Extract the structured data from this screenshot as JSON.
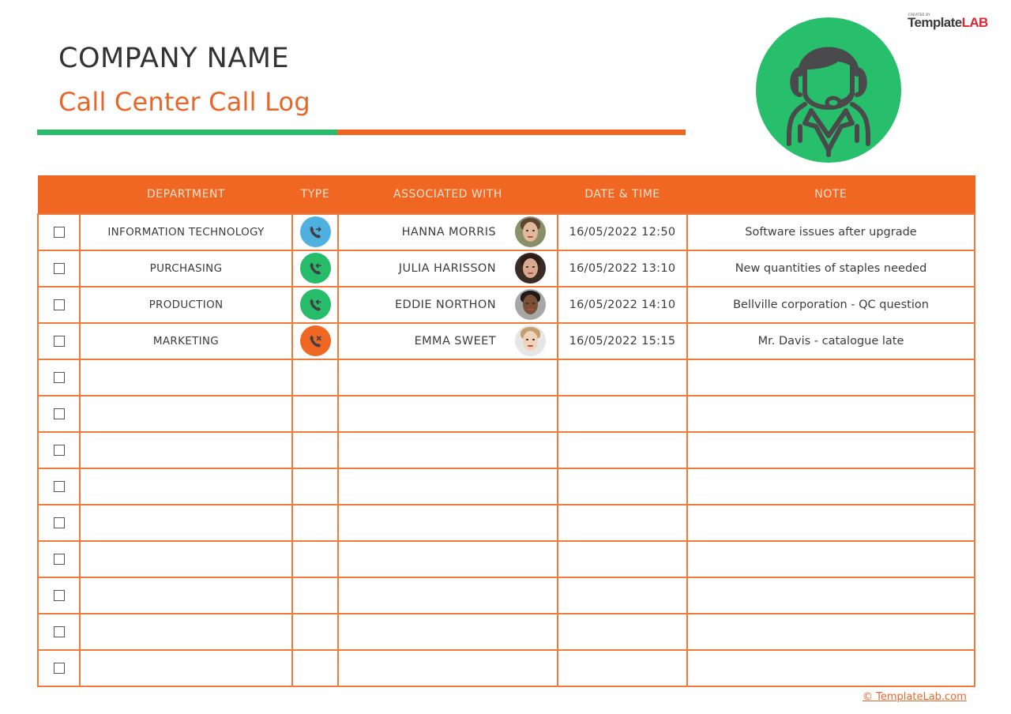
{
  "header": {
    "company_name": "COMPANY NAME",
    "title": "Call Center Call Log",
    "colors": {
      "green": "#27bc6a",
      "orange": "#ef6522",
      "dark": "#333333"
    }
  },
  "agent_badge": {
    "icon": "call-center-agent-icon",
    "background": "#27bf6c"
  },
  "brand": {
    "tagline": "CREATED BY",
    "name_part1": "Template",
    "name_part2": "LAB"
  },
  "table": {
    "columns": [
      {
        "key": "check",
        "label": ""
      },
      {
        "key": "department",
        "label": "DEPARTMENT"
      },
      {
        "key": "type",
        "label": "TYPE"
      },
      {
        "key": "associated_with",
        "label": "ASSOCIATED WITH"
      },
      {
        "key": "date_time",
        "label": "DATE & TIME"
      },
      {
        "key": "note",
        "label": "NOTE"
      }
    ],
    "header_color": "#f06623",
    "rows": [
      {
        "checked": false,
        "department": "INFORMATION TECHNOLOGY",
        "type": "outgoing",
        "type_icon": "outgoing-call-icon",
        "type_color": "#4fb1e0",
        "associated_with": "HANNA MORRIS",
        "avatar": "avatar-hanna-morris",
        "date_time": "16/05/2022 12:50",
        "note": "Software issues after upgrade"
      },
      {
        "checked": false,
        "department": "PURCHASING",
        "type": "incoming",
        "type_icon": "incoming-call-icon",
        "type_color": "#27bc6a",
        "associated_with": "JULIA HARISSON",
        "avatar": "avatar-julia-harisson",
        "date_time": "16/05/2022 13:10",
        "note": "New quantities of staples needed"
      },
      {
        "checked": false,
        "department": "PRODUCTION",
        "type": "incoming",
        "type_icon": "incoming-call-icon",
        "type_color": "#27bc6a",
        "associated_with": "EDDIE NORTHON",
        "avatar": "avatar-eddie-northon",
        "date_time": "16/05/2022 14:10",
        "note": "Bellville corporation - QC question"
      },
      {
        "checked": false,
        "department": "MARKETING",
        "type": "missed",
        "type_icon": "missed-call-icon",
        "type_color": "#f06623",
        "associated_with": "EMMA SWEET",
        "avatar": "avatar-emma-sweet",
        "date_time": "16/05/2022 15:15",
        "note": "Mr. Davis - catalogue late"
      },
      {
        "checked": false,
        "department": "",
        "type": "",
        "associated_with": "",
        "date_time": "",
        "note": ""
      },
      {
        "checked": false,
        "department": "",
        "type": "",
        "associated_with": "",
        "date_time": "",
        "note": ""
      },
      {
        "checked": false,
        "department": "",
        "type": "",
        "associated_with": "",
        "date_time": "",
        "note": ""
      },
      {
        "checked": false,
        "department": "",
        "type": "",
        "associated_with": "",
        "date_time": "",
        "note": ""
      },
      {
        "checked": false,
        "department": "",
        "type": "",
        "associated_with": "",
        "date_time": "",
        "note": ""
      },
      {
        "checked": false,
        "department": "",
        "type": "",
        "associated_with": "",
        "date_time": "",
        "note": ""
      },
      {
        "checked": false,
        "department": "",
        "type": "",
        "associated_with": "",
        "date_time": "",
        "note": ""
      },
      {
        "checked": false,
        "department": "",
        "type": "",
        "associated_with": "",
        "date_time": "",
        "note": ""
      },
      {
        "checked": false,
        "department": "",
        "type": "",
        "associated_with": "",
        "date_time": "",
        "note": ""
      }
    ]
  },
  "footer": {
    "link_text": "© TemplateLab.com"
  }
}
